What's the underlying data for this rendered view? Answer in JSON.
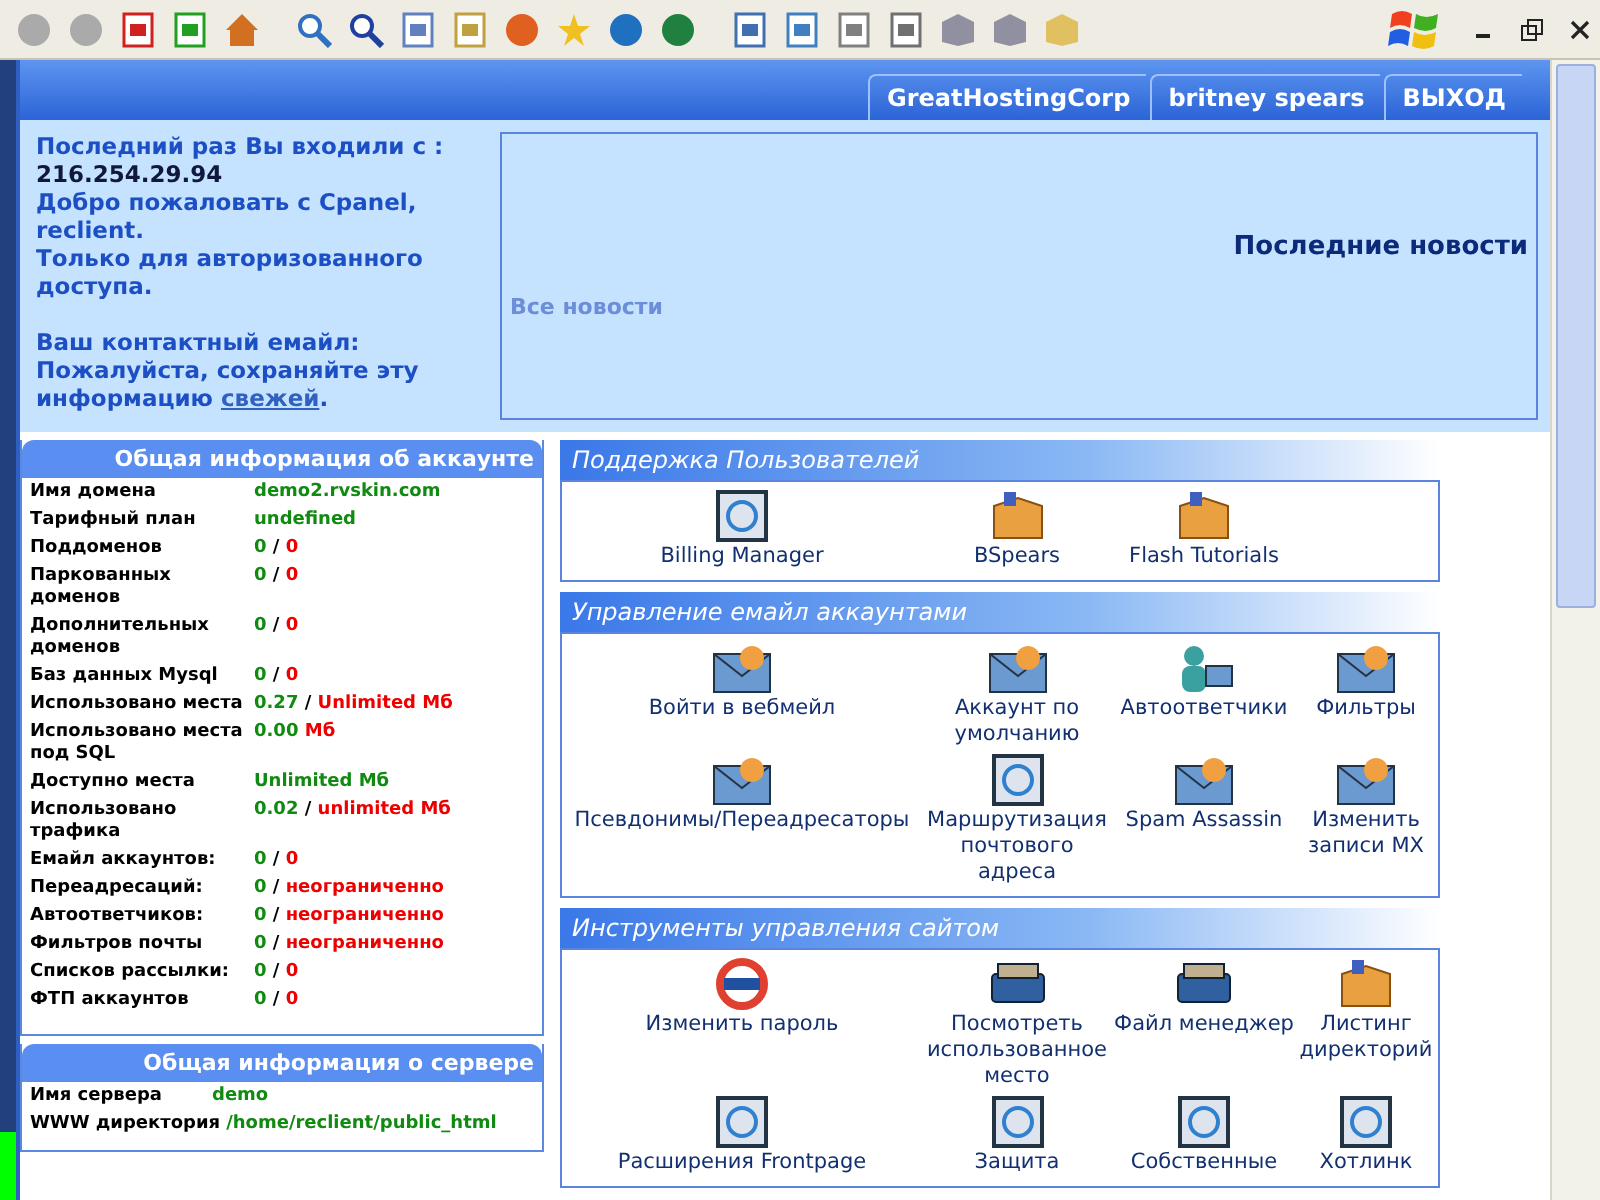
{
  "header_tabs": [
    {
      "label": "GreatHostingCorp"
    },
    {
      "label": "britney spears"
    },
    {
      "label": "ВЫХОД"
    }
  ],
  "welcome": {
    "last_login_label": "Последний раз Вы входили с :",
    "ip": "216.254.29.94",
    "greeting": "Добро пожаловать с Cpanel, reclient.",
    "auth_note": "Только для авторизованного доступа.",
    "email_label": "Ваш контактный емайл:",
    "keep_note": "Пожалуйста, сохраняйте эту информацию",
    "keep_link": "свежей",
    "keep_end": "."
  },
  "news": {
    "title": "Последние новости",
    "all_link": "Все новости"
  },
  "account_info": {
    "title": "Общая информация об аккаунте",
    "rows": [
      {
        "label": "Имя домена",
        "value": [
          {
            "text": "demo2.rvskin.com",
            "kind": "used"
          }
        ]
      },
      {
        "label": "Тарифный план",
        "value": [
          {
            "text": "undefined",
            "kind": "used"
          }
        ]
      },
      {
        "label": "Поддоменов",
        "value": [
          {
            "text": "0",
            "kind": "used"
          },
          {
            "text": "/",
            "kind": "sep"
          },
          {
            "text": "0",
            "kind": "limit"
          }
        ]
      },
      {
        "label": "Паркованных доменов",
        "value": [
          {
            "text": "0",
            "kind": "used"
          },
          {
            "text": "/",
            "kind": "sep"
          },
          {
            "text": "0",
            "kind": "limit"
          }
        ]
      },
      {
        "label": "Дополнительных доменов",
        "value": [
          {
            "text": "0",
            "kind": "used"
          },
          {
            "text": "/",
            "kind": "sep"
          },
          {
            "text": "0",
            "kind": "limit"
          }
        ]
      },
      {
        "label": "Баз данных Mysql",
        "value": [
          {
            "text": "0",
            "kind": "used"
          },
          {
            "text": "/",
            "kind": "sep"
          },
          {
            "text": "0",
            "kind": "limit"
          }
        ]
      },
      {
        "label": "Использовано места",
        "value": [
          {
            "text": "0.27",
            "kind": "used"
          },
          {
            "text": "/",
            "kind": "sep"
          },
          {
            "text": "Unlimited Мб",
            "kind": "limit"
          }
        ]
      },
      {
        "label": "Использовано места под SQL",
        "value": [
          {
            "text": "0.00",
            "kind": "used"
          },
          {
            "text": "Мб",
            "kind": "limit"
          }
        ]
      },
      {
        "label": "Доступно места",
        "value": [
          {
            "text": "Unlimited Мб",
            "kind": "used"
          }
        ]
      },
      {
        "label": "Использовано трафика",
        "value": [
          {
            "text": "0.02",
            "kind": "used"
          },
          {
            "text": "/",
            "kind": "sep"
          },
          {
            "text": "unlimited Мб",
            "kind": "limit"
          }
        ]
      },
      {
        "label": "Емайл аккаунтов:",
        "value": [
          {
            "text": "0",
            "kind": "used"
          },
          {
            "text": "/",
            "kind": "sep"
          },
          {
            "text": "0",
            "kind": "limit"
          }
        ]
      },
      {
        "label": "Переадресаций:",
        "value": [
          {
            "text": "0",
            "kind": "used"
          },
          {
            "text": "/",
            "kind": "sep"
          },
          {
            "text": "неограниченно",
            "kind": "limit"
          }
        ]
      },
      {
        "label": "Автоответчиков:",
        "value": [
          {
            "text": "0",
            "kind": "used"
          },
          {
            "text": "/",
            "kind": "sep"
          },
          {
            "text": "неограниченно",
            "kind": "limit"
          }
        ]
      },
      {
        "label": "Фильтров почты",
        "value": [
          {
            "text": "0",
            "kind": "used"
          },
          {
            "text": "/",
            "kind": "sep"
          },
          {
            "text": "неограниченно",
            "kind": "limit"
          }
        ]
      },
      {
        "label": "Списков рассылки:",
        "value": [
          {
            "text": "0",
            "kind": "used"
          },
          {
            "text": "/",
            "kind": "sep"
          },
          {
            "text": "0",
            "kind": "limit"
          }
        ]
      },
      {
        "label": "ФТП аккаунтов",
        "value": [
          {
            "text": "0",
            "kind": "used"
          },
          {
            "text": "/",
            "kind": "sep"
          },
          {
            "text": "0",
            "kind": "limit"
          }
        ]
      }
    ]
  },
  "server_info": {
    "title": "Общая информация о сервере",
    "rows": [
      {
        "label": "Имя сервера",
        "value": [
          {
            "text": "demo",
            "kind": "used"
          }
        ]
      },
      {
        "label": "WWW директория",
        "value": [
          {
            "text": "/home/reclient/public_html",
            "kind": "used"
          }
        ]
      }
    ]
  },
  "sections": [
    {
      "title": "Поддержка Пользователей",
      "items": [
        {
          "label": "Billing Manager"
        },
        {
          "label": "BSpears"
        },
        {
          "label": "Flash Tutorials"
        }
      ]
    },
    {
      "title": "Управление емайл аккаунтами",
      "items": [
        {
          "label": "Войти в вебмейл"
        },
        {
          "label": "Аккаунт по умолчанию"
        },
        {
          "label": "Автоответчики"
        },
        {
          "label": "Фильтры"
        },
        {
          "label": "Псевдонимы/Переадресаторы"
        },
        {
          "label": "Маршрутизация почтового адреса"
        },
        {
          "label": "Spam Assassin"
        },
        {
          "label": "Изменить записи MX"
        }
      ]
    },
    {
      "title": "Инструменты управления сайтом",
      "items": [
        {
          "label": "Изменить пароль"
        },
        {
          "label": "Посмотреть использованное место"
        },
        {
          "label": "Файл менеджер"
        },
        {
          "label": "Листинг директорий"
        },
        {
          "label": "Расширения Frontpage"
        },
        {
          "label": "Защита"
        },
        {
          "label": "Собственные"
        },
        {
          "label": "Хотлинк"
        }
      ]
    }
  ]
}
